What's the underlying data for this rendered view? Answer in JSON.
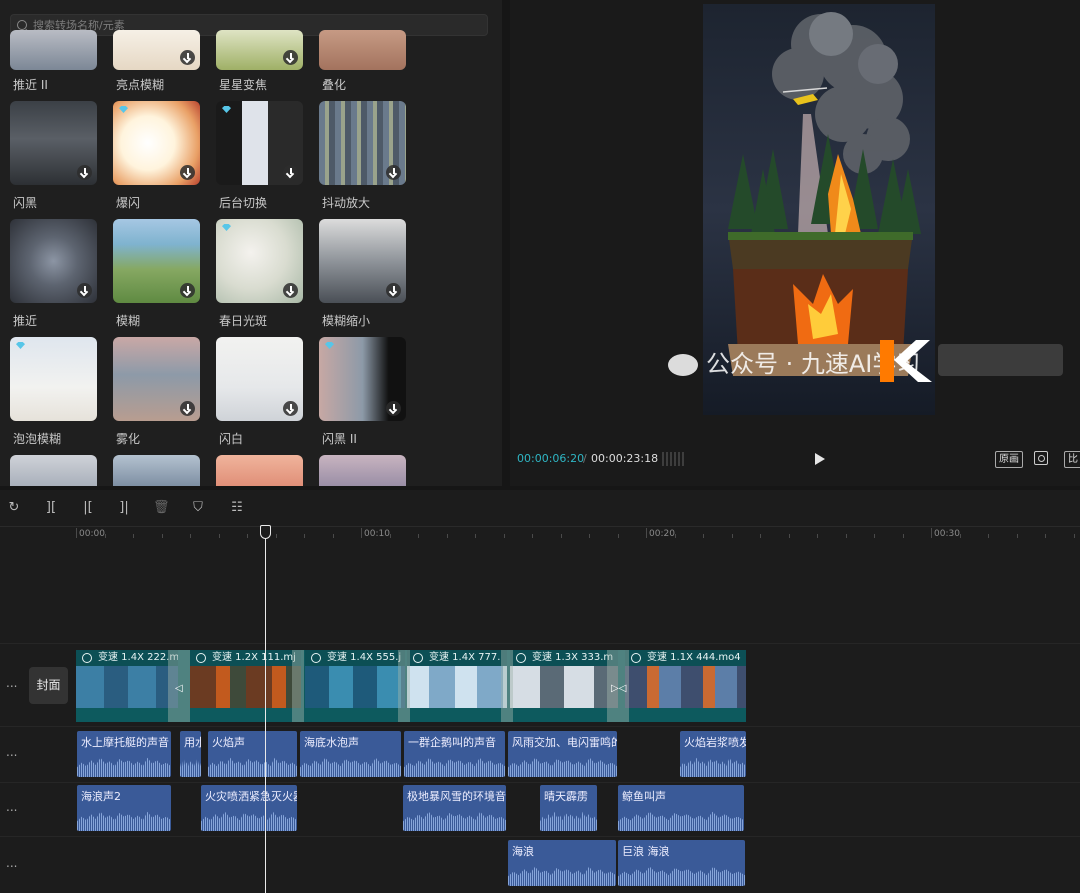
{
  "search": {
    "placeholder": "搜索转场名称/元素"
  },
  "transitions": [
    "推近 II",
    "亮点模糊",
    "星星变焦",
    "叠化",
    "闪黑",
    "爆闪",
    "后台切换",
    "抖动放大",
    "推近",
    "模糊",
    "春日光斑",
    "模糊缩小",
    "泡泡模糊",
    "雾化",
    "闪白",
    "闪黑 II"
  ],
  "player": {
    "current_time": "00:00:06:20",
    "separator": "/",
    "total_time": "00:00:23:18",
    "original_label": "原画",
    "ratio_label": "比"
  },
  "ruler": [
    "00:00",
    "00:10",
    "00:20",
    "00:30"
  ],
  "timeline": {
    "cover_label": "封面",
    "more": "...",
    "video_clips": [
      "变速 1.4X  222.m",
      "变速 1.2X  111.mj",
      "变速 1.4X  555.j",
      "变速 1.4X  777.",
      "变速 1.3X  333.m",
      "变速 1.1X  444.mo4"
    ],
    "audio_track_1": [
      "水上摩托艇的声音",
      "用水",
      "火焰声",
      "海底水泡声",
      "一群企鹅叫的声音",
      "风雨交加、电闪雷鸣的声",
      "火焰岩浆喷发"
    ],
    "audio_track_2": [
      "海浪声2",
      "火灾喷洒紧急灭火器",
      "极地暴风雪的环境音效",
      "晴天霹雳",
      "鲸鱼叫声"
    ],
    "audio_track_3": [
      "海浪",
      "巨浪 海浪"
    ]
  },
  "watermark": "公众号 · 九速AI学习"
}
